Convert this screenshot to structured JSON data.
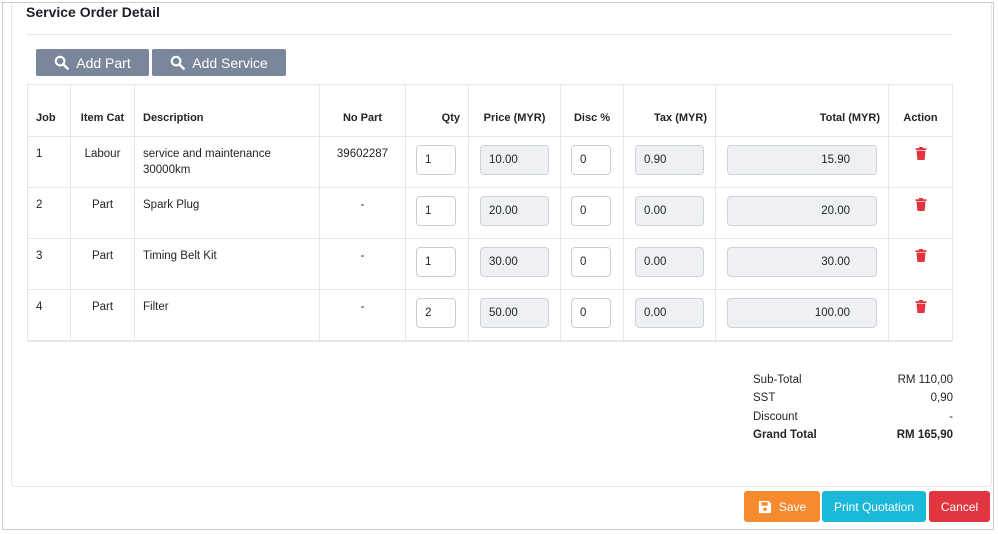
{
  "page": {
    "title": "Service Order Detail"
  },
  "toolbar": {
    "add_part_label": "Add Part",
    "add_service_label": "Add Service"
  },
  "table": {
    "headers": {
      "job": "Job",
      "item_cat": "Item Cat",
      "description": "Description",
      "no_part": "No Part",
      "qty": "Qty",
      "price": "Price (MYR)",
      "disc": "Disc %",
      "tax": "Tax (MYR)",
      "total": "Total (MYR)",
      "action": "Action"
    },
    "rows": [
      {
        "job": "1",
        "item_cat": "Labour",
        "description": "service and maintenance 30000km",
        "no_part": "39602287",
        "qty": "1",
        "price": "10.00",
        "disc": "0",
        "tax": "0.90",
        "total": "15.90"
      },
      {
        "job": "2",
        "item_cat": "Part",
        "description": "Spark Plug",
        "no_part": "-",
        "qty": "1",
        "price": "20.00",
        "disc": "0",
        "tax": "0.00",
        "total": "20.00"
      },
      {
        "job": "3",
        "item_cat": "Part",
        "description": "Timing Belt Kit",
        "no_part": "-",
        "qty": "1",
        "price": "30.00",
        "disc": "0",
        "tax": "0.00",
        "total": "30.00"
      },
      {
        "job": "4",
        "item_cat": "Part",
        "description": "Filter",
        "no_part": "-",
        "qty": "2",
        "price": "50.00",
        "disc": "0",
        "tax": "0.00",
        "total": "100.00"
      }
    ]
  },
  "summary": {
    "subtotal_label": "Sub-Total",
    "subtotal_value": "RM 110,00",
    "sst_label": "SST",
    "sst_value": "0,90",
    "discount_label": "Discount",
    "discount_value": "-",
    "grand_total_label": "Grand Total",
    "grand_total_value": "RM 165,90"
  },
  "actions": {
    "save_label": "Save",
    "print_label": "Print Quotation",
    "cancel_label": "Cancel"
  },
  "icons": {
    "search": "search-icon",
    "trash": "trash-icon",
    "save": "floppy-disk-icon"
  },
  "colors": {
    "gray_button": "#7a8699",
    "save": "#f58a2e",
    "print": "#1ab9d9",
    "cancel": "#e2353f",
    "trash": "#e2353f"
  }
}
